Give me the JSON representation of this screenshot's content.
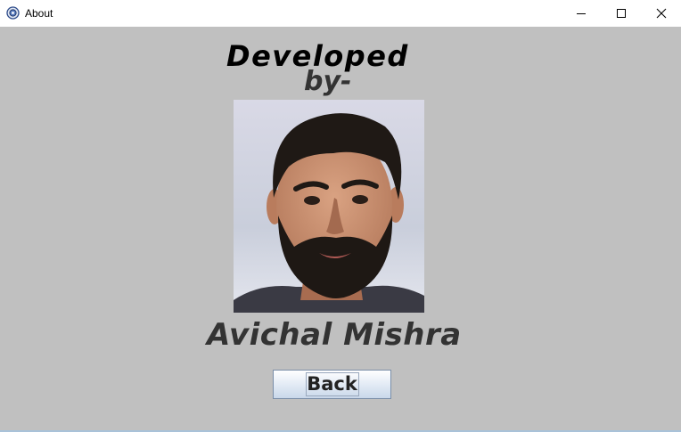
{
  "window": {
    "title": "About",
    "app_icon": "java-cup-icon",
    "controls": {
      "minimize_icon": "minimize-icon",
      "maximize_icon": "maximize-icon",
      "close_icon": "close-icon"
    }
  },
  "about": {
    "heading_line1": "Developed",
    "heading_line2": "by-",
    "photo": "developer-portrait",
    "name": "Avichal Mishra",
    "back_label": "Back"
  },
  "colors": {
    "background": "#c0c0c0",
    "titlebar": "#ffffff",
    "heading_text": "#000000",
    "name_text": "#333333"
  }
}
